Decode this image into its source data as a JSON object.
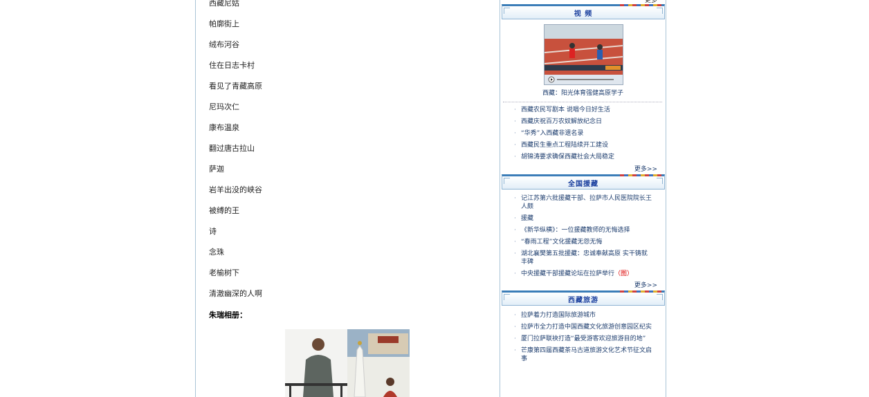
{
  "poems": [
    "西藏尼姑",
    "帕廓街上",
    "绒布河谷",
    "住在日志卡村",
    "看见了青藏高原",
    "尼玛次仁",
    "康布温泉",
    "翻过唐古拉山",
    "萨迦",
    "岩羊出没的峡谷",
    "被缚的王",
    "诗",
    "念珠",
    "老榆树下",
    "清澈幽深的人啊"
  ],
  "album_title": "朱瑞相册：",
  "sidebar": {
    "top_more": "更多",
    "video": {
      "title": "视  频",
      "caption": "西藏：阳光体育强健高原学子",
      "items": [
        "西藏农民写剧本 说唱今日好生活",
        "西藏庆祝百万农奴解放纪念日",
        "“华秀”入西藏非遗名录",
        "西藏民生重点工程陆续开工建设",
        "胡锦涛要求确保西藏社会大局稳定"
      ],
      "more": "更多>>"
    },
    "aid": {
      "title": "全国援藏",
      "items": [
        {
          "text": "记江苏第六批援藏干部、拉萨市人民医院院长王人颇",
          "tag": ""
        },
        {
          "text": "援藏",
          "tag": ""
        },
        {
          "text": "《新华纵横》：一位援藏教师的无悔选择",
          "tag": ""
        },
        {
          "text": "“春雨工程”文化援藏无怨无悔",
          "tag": ""
        },
        {
          "text": "湖北襄樊第五批援藏：忠诚奉献高原 实干铸就丰碑",
          "tag": ""
        },
        {
          "text": "中央援藏干部援藏论坛在拉萨举行",
          "tag": "（图）"
        }
      ],
      "more": "更多>>"
    },
    "travel": {
      "title": "西藏旅游",
      "items": [
        "拉萨着力打造国际旅游城市",
        "拉萨市全力打造中国西藏文化旅游创意园区纪实",
        "厦门拉萨联袂打造“最受游客欢迎旅游目的地”",
        "芒康第四届西藏茶马古道旅游文化艺术节征文启事"
      ]
    }
  },
  "colors": {
    "link": "#1d3d6e",
    "header_title": "#1a3f9e",
    "accent_red": "#dd0000",
    "border": "#a9c3d6"
  }
}
